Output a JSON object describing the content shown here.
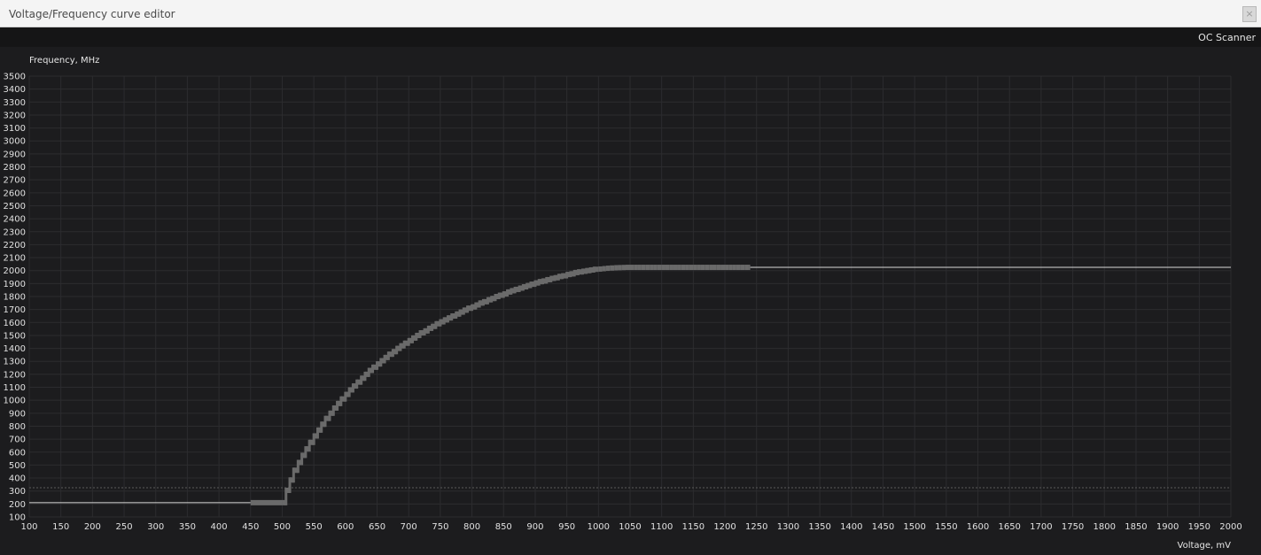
{
  "window": {
    "title": "Voltage/Frequency curve editor",
    "close_symbol": "×"
  },
  "toolbar": {
    "oc_scanner_label": "OC Scanner"
  },
  "colors": {
    "background": "#1c1c1e",
    "grid": "#2c2c2f",
    "curve_points": "#6a6a6a",
    "flat_line": "#d8d8d8",
    "dotted_line": "#5a5a5a"
  },
  "chart_data": {
    "type": "line",
    "xlabel": "Voltage, mV",
    "ylabel": "Frequency, MHz",
    "xlim": [
      100,
      2000
    ],
    "ylim": [
      100,
      3500
    ],
    "x_ticks": [
      100,
      150,
      200,
      250,
      300,
      350,
      400,
      450,
      500,
      550,
      600,
      650,
      700,
      750,
      800,
      850,
      900,
      950,
      1000,
      1050,
      1100,
      1150,
      1200,
      1250,
      1300,
      1350,
      1400,
      1450,
      1500,
      1550,
      1600,
      1650,
      1700,
      1750,
      1800,
      1850,
      1900,
      1950,
      2000
    ],
    "y_ticks": [
      100,
      200,
      300,
      400,
      500,
      600,
      700,
      800,
      900,
      1000,
      1100,
      1200,
      1300,
      1400,
      1500,
      1600,
      1700,
      1800,
      1900,
      2000,
      2100,
      2200,
      2300,
      2400,
      2500,
      2600,
      2700,
      2800,
      2900,
      3000,
      3100,
      3200,
      3300,
      3400,
      3500
    ],
    "grid": true,
    "dotted_reference_frequency": 325,
    "flat_segments": [
      {
        "x": [
          100,
          450
        ],
        "y": 210
      },
      {
        "x": [
          1240,
          2000
        ],
        "y": 2025
      }
    ],
    "series": [
      {
        "x": [
          450,
          500,
          506,
          512,
          518,
          525,
          531,
          537,
          543,
          550,
          556,
          562,
          568,
          575,
          581,
          587,
          593,
          600,
          606,
          612,
          618,
          625,
          631,
          637,
          643,
          650,
          656,
          662,
          668,
          675,
          681,
          687,
          693,
          700,
          706,
          712,
          718,
          725,
          731,
          737,
          743,
          750,
          756,
          762,
          768,
          775,
          781,
          787,
          793,
          800,
          806,
          812,
          818,
          825,
          831,
          837,
          843,
          850,
          856,
          862,
          868,
          875,
          881,
          887,
          893,
          900,
          906,
          912,
          918,
          925,
          931,
          937,
          943,
          950,
          956,
          962,
          968,
          975,
          981,
          987,
          993,
          1000,
          1006,
          1012,
          1018,
          1025,
          1031,
          1037,
          1043,
          1050,
          1056,
          1062,
          1068,
          1075,
          1081,
          1087,
          1093,
          1100,
          1106,
          1112,
          1118,
          1125,
          1131,
          1137,
          1143,
          1150,
          1156,
          1162,
          1168,
          1175,
          1181,
          1187,
          1193,
          1200,
          1206,
          1212,
          1218,
          1225,
          1231,
          1237,
          1240
        ],
        "y": [
          210,
          210,
          305,
          385,
          460,
          520,
          575,
          625,
          675,
          725,
          770,
          815,
          860,
          900,
          940,
          975,
          1010,
          1045,
          1080,
          1110,
          1140,
          1170,
          1200,
          1230,
          1255,
          1280,
          1305,
          1330,
          1355,
          1375,
          1400,
          1420,
          1440,
          1460,
          1480,
          1500,
          1520,
          1535,
          1555,
          1570,
          1590,
          1605,
          1620,
          1635,
          1650,
          1665,
          1680,
          1695,
          1710,
          1720,
          1735,
          1750,
          1760,
          1775,
          1785,
          1800,
          1810,
          1820,
          1835,
          1845,
          1855,
          1865,
          1875,
          1885,
          1895,
          1905,
          1915,
          1920,
          1930,
          1940,
          1945,
          1955,
          1960,
          1970,
          1975,
          1985,
          1990,
          1995,
          2000,
          2005,
          2010,
          2012,
          2015,
          2018,
          2020,
          2022,
          2023,
          2024,
          2025,
          2025,
          2025,
          2025,
          2025,
          2025,
          2025,
          2025,
          2025,
          2025,
          2025,
          2025,
          2025,
          2025,
          2025,
          2025,
          2025,
          2025,
          2025,
          2025,
          2025,
          2025,
          2025,
          2025,
          2025,
          2025,
          2025,
          2025,
          2025,
          2025,
          2025,
          2025,
          2025
        ]
      }
    ]
  }
}
